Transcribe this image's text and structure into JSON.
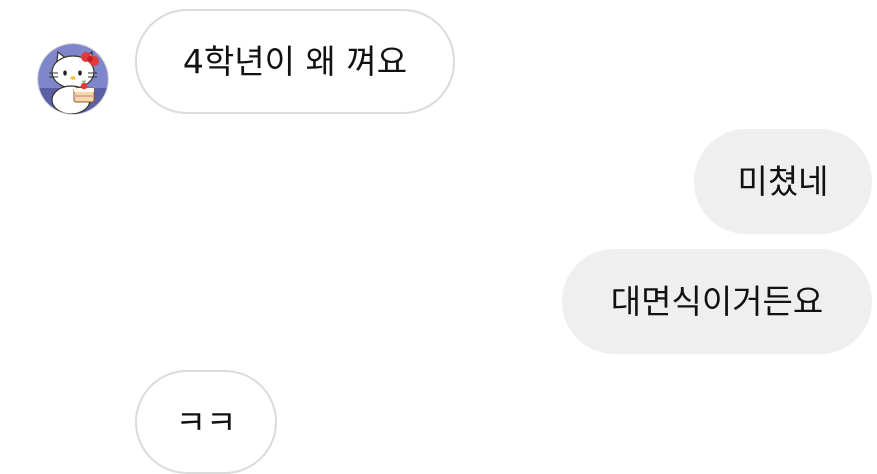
{
  "conversation": {
    "incoming_avatar_icon": "hello-kitty-cake-avatar-icon",
    "messages": [
      {
        "direction": "incoming",
        "text": "4학년이 왜 껴요"
      },
      {
        "direction": "outgoing",
        "text": "미쳤네"
      },
      {
        "direction": "outgoing",
        "text": "대면식이거든요"
      },
      {
        "direction": "incoming",
        "text": "ㅋㅋ"
      }
    ]
  },
  "colors": {
    "incoming_bubble_bg": "#ffffff",
    "incoming_bubble_border": "#dbdbdb",
    "outgoing_bubble_bg": "#efefef",
    "text": "#111111"
  }
}
